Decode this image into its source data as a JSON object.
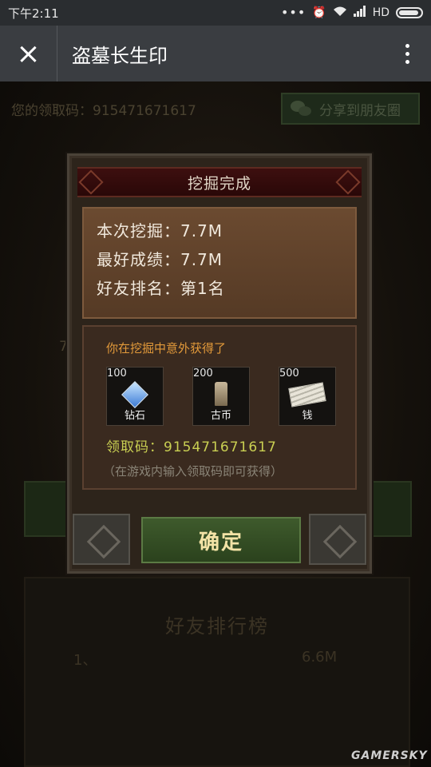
{
  "status_bar": {
    "time": "下午2:11",
    "indicators": "HD",
    "dots": "•••"
  },
  "header": {
    "close_icon": "×",
    "title": "盗墓长生印"
  },
  "background": {
    "claim_code_text": "您的领取码：915471671617",
    "share_label": "分享到朋友圈",
    "partial_number": "7",
    "leaderboard_title": "好友排行榜",
    "leaderboard_rank": "1、",
    "leaderboard_score": "6.6M"
  },
  "dialog": {
    "title": "挖掘完成",
    "results": [
      "本次挖掘：7.7M",
      "最好成绩：7.7M",
      "好友排名：第1名"
    ],
    "reward_heading": "你在挖掘中意外获得了",
    "rewards": [
      {
        "count": "100",
        "name": "钻石",
        "icon": "diamond-icon"
      },
      {
        "count": "200",
        "name": "古币",
        "icon": "ancient-coin-icon"
      },
      {
        "count": "500",
        "name": "钱",
        "icon": "cash-icon"
      }
    ],
    "code_line": "领取码：915471671617",
    "hint": "（在游戏内输入领取码即可获得）",
    "confirm_label": "确定"
  },
  "watermark": "GAMERSKY"
}
